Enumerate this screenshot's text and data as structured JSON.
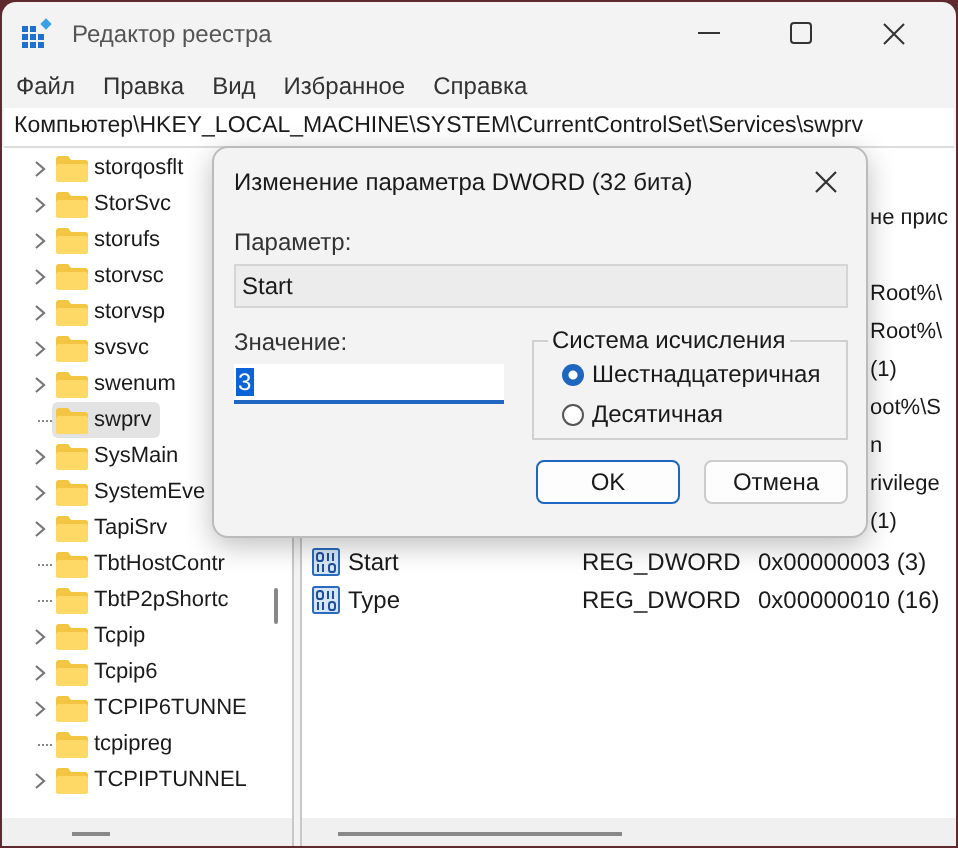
{
  "window": {
    "title": "Редактор реестра"
  },
  "menu": [
    "Файл",
    "Правка",
    "Вид",
    "Избранное",
    "Справка"
  ],
  "address": "Компьютер\\HKEY_LOCAL_MACHINE\\SYSTEM\\CurrentControlSet\\Services\\swprv",
  "tree": {
    "items": [
      {
        "label": "storqosflt",
        "has_children": true,
        "selected": false
      },
      {
        "label": "StorSvc",
        "has_children": true,
        "selected": false
      },
      {
        "label": "storufs",
        "has_children": true,
        "selected": false
      },
      {
        "label": "storvsc",
        "has_children": true,
        "selected": false
      },
      {
        "label": "storvsp",
        "has_children": true,
        "selected": false
      },
      {
        "label": "svsvc",
        "has_children": true,
        "selected": false
      },
      {
        "label": "swenum",
        "has_children": true,
        "selected": false
      },
      {
        "label": "swprv",
        "has_children": false,
        "selected": true
      },
      {
        "label": "SysMain",
        "has_children": true,
        "selected": false
      },
      {
        "label": "SystemEve",
        "has_children": true,
        "selected": false
      },
      {
        "label": "TapiSrv",
        "has_children": true,
        "selected": false
      },
      {
        "label": "TbtHostContr",
        "has_children": false,
        "selected": false
      },
      {
        "label": "TbtP2pShortc",
        "has_children": false,
        "selected": false
      },
      {
        "label": "Tcpip",
        "has_children": true,
        "selected": false
      },
      {
        "label": "Tcpip6",
        "has_children": true,
        "selected": false
      },
      {
        "label": "TCPIP6TUNNE",
        "has_children": true,
        "selected": false
      },
      {
        "label": "tcpipreg",
        "has_children": false,
        "selected": false
      },
      {
        "label": "TCPIPTUNNEL",
        "has_children": true,
        "selected": false
      }
    ]
  },
  "values": {
    "fragments": [
      "не прис",
      "Root%\\",
      "Root%\\",
      "(1)",
      "oot%\\S",
      "n",
      "rivilege",
      "(1)"
    ],
    "rows": [
      {
        "name": "Start",
        "type": "REG_DWORD",
        "data": "0x00000003 (3)"
      },
      {
        "name": "Type",
        "type": "REG_DWORD",
        "data": "0x00000010 (16)"
      }
    ]
  },
  "dialog": {
    "title": "Изменение параметра DWORD (32 бита)",
    "name_label": "Параметр:",
    "name_value": "Start",
    "value_label": "Значение:",
    "value": "3",
    "value_highlighted": true,
    "base_group": "Система исчисления",
    "bases": [
      {
        "label": "Шестнадцатеричная",
        "selected": true
      },
      {
        "label": "Десятичная",
        "selected": false
      }
    ],
    "buttons": [
      {
        "label": "OK",
        "default": true
      },
      {
        "label": "Отмена",
        "default": false
      }
    ]
  }
}
